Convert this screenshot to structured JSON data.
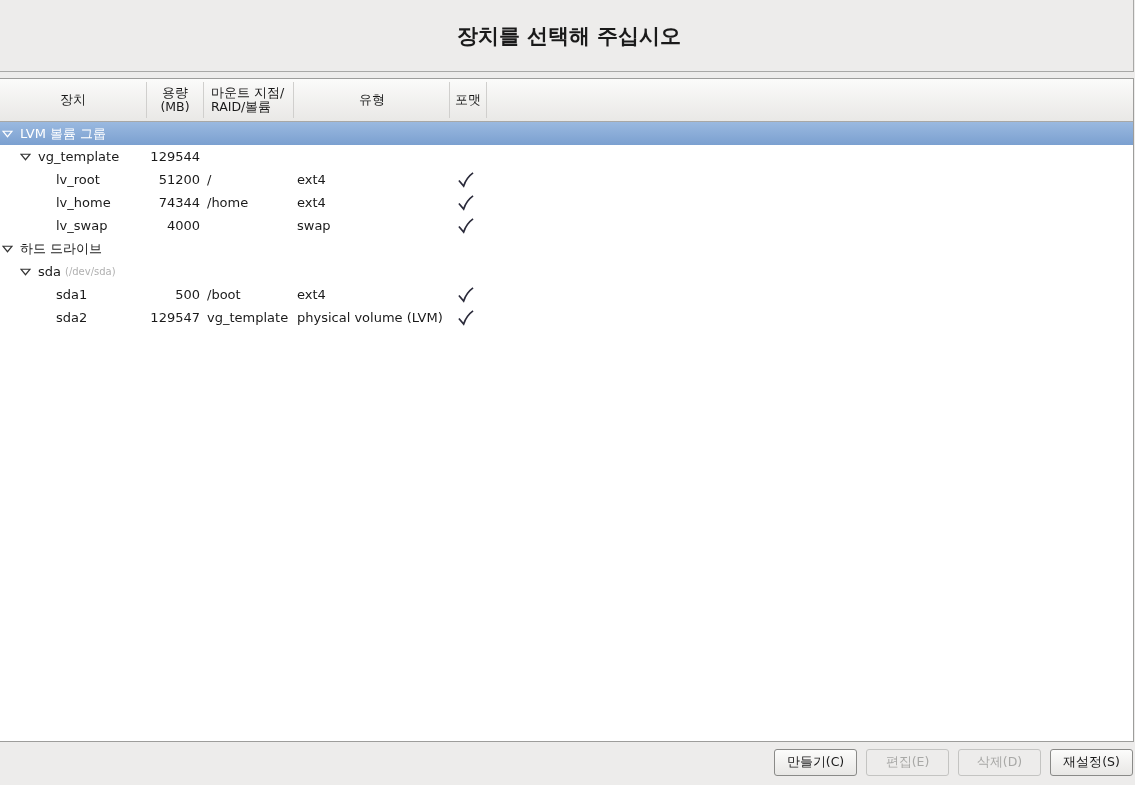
{
  "header": {
    "title": "장치를 선택해 주십시오"
  },
  "table": {
    "columns": [
      "장치",
      "용량\n(MB)",
      "마운트 지점/\nRAID/볼륨",
      "유형",
      "포맷"
    ],
    "rows": [
      {
        "name": "LVM 볼륨 그룹",
        "expanded": true,
        "selected": true,
        "children": [
          {
            "name": "vg_template",
            "size": "129544",
            "expanded": true,
            "selected": false,
            "children": [
              {
                "name": "lv_root",
                "size": "51200",
                "mount": "/",
                "type": "ext4",
                "format": true,
                "selected": false
              },
              {
                "name": "lv_home",
                "size": "74344",
                "mount": "/home",
                "type": "ext4",
                "format": true,
                "selected": false
              },
              {
                "name": "lv_swap",
                "size": "4000",
                "type": "swap",
                "format": true,
                "selected": false
              }
            ]
          }
        ]
      },
      {
        "name": "하드 드라이브",
        "expanded": true,
        "selected": false,
        "children": [
          {
            "name": "sda",
            "note": "(/dev/sda)",
            "expanded": true,
            "selected": false,
            "children": [
              {
                "name": "sda1",
                "size": "500",
                "mount": "/boot",
                "type": "ext4",
                "format": true,
                "selected": false
              },
              {
                "name": "sda2",
                "size": "129547",
                "mount": "vg_template",
                "type": "physical volume (LVM)",
                "format": true,
                "selected": false
              }
            ]
          }
        ]
      }
    ]
  },
  "buttons": [
    {
      "label": "만들기(C)",
      "disabled": false
    },
    {
      "label": "편집(E)",
      "disabled": true
    },
    {
      "label": "삭제(D)",
      "disabled": true
    },
    {
      "label": "재설정(S)",
      "disabled": false
    }
  ]
}
